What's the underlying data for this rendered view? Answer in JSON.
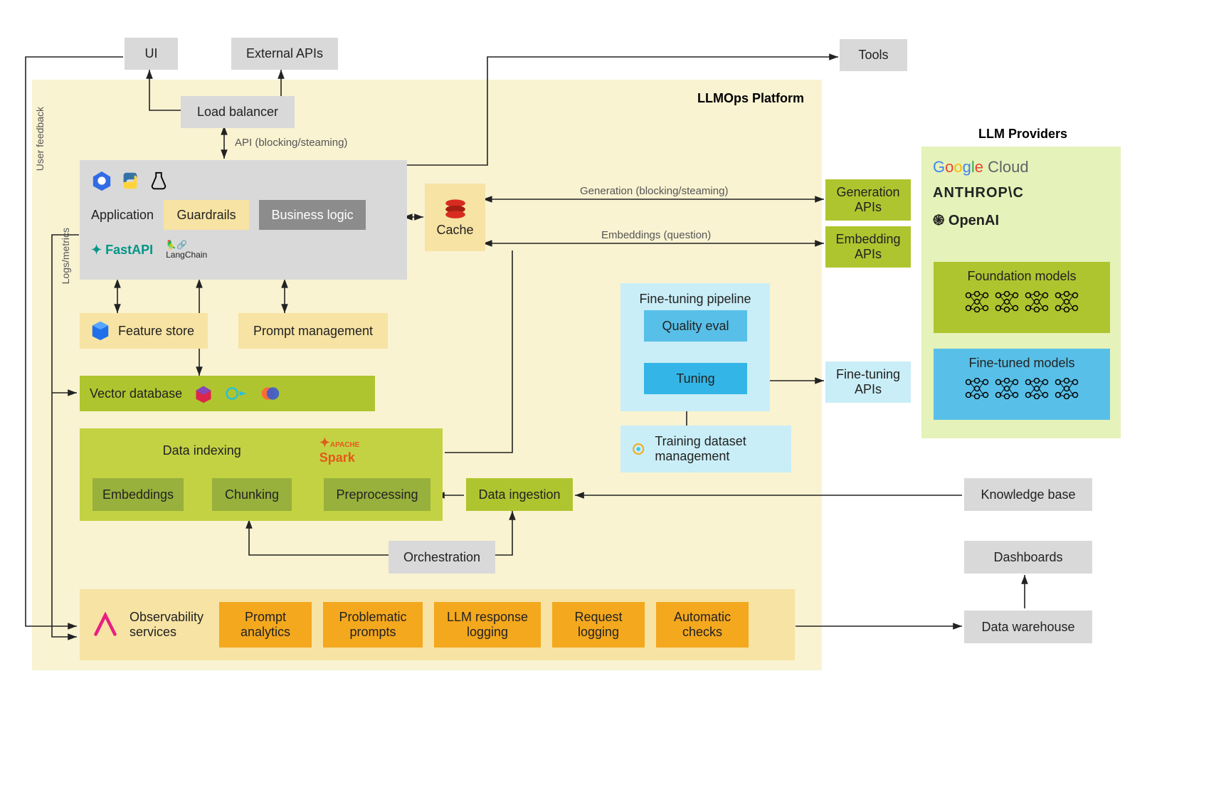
{
  "platform_title": "LLMOps Platform",
  "providers_title": "LLM Providers",
  "top": {
    "ui": "UI",
    "external_apis": "External APIs",
    "tools": "Tools"
  },
  "load_balancer": "Load balancer",
  "api_note": "API (blocking/steaming)",
  "application": {
    "title": "Application",
    "guardrails": "Guardrails",
    "business_logic": "Business logic",
    "fastapi": "FastAPI",
    "langchain": "LangChain"
  },
  "cache": "Cache",
  "generation_note": "Generation (blocking/steaming)",
  "embeddings_note": "Embeddings (question)",
  "feature_store": "Feature store",
  "prompt_management": "Prompt management",
  "vector_db": "Vector database",
  "data_indexing": {
    "title": "Data indexing",
    "embeddings": "Embeddings",
    "chunking": "Chunking",
    "preprocessing": "Preprocessing",
    "spark": "Spark"
  },
  "data_ingestion": "Data ingestion",
  "orchestration": "Orchestration",
  "observability": {
    "title": "Observability services",
    "items": [
      "Prompt analytics",
      "Problematic prompts",
      "LLM response logging",
      "Request logging",
      "Automatic checks"
    ]
  },
  "ft_pipeline": {
    "title": "Fine-tuning pipeline",
    "quality_eval": "Quality eval",
    "tuning": "Tuning"
  },
  "training_ds": "Training dataset management",
  "ft_apis": "Fine-tuning APIs",
  "gen_apis": "Generation APIs",
  "emb_apis": "Embedding APIs",
  "foundation_models": "Foundation models",
  "finetuned_models": "Fine-tuned models",
  "knowledge_base": "Knowledge base",
  "dashboards": "Dashboards",
  "data_warehouse": "Data warehouse",
  "user_feedback": "User feedback",
  "logs_metrics": "Logs/metrics",
  "providers": {
    "google": "Google Cloud",
    "anthropic": "ANTHROP\\C",
    "openai": "OpenAI"
  }
}
